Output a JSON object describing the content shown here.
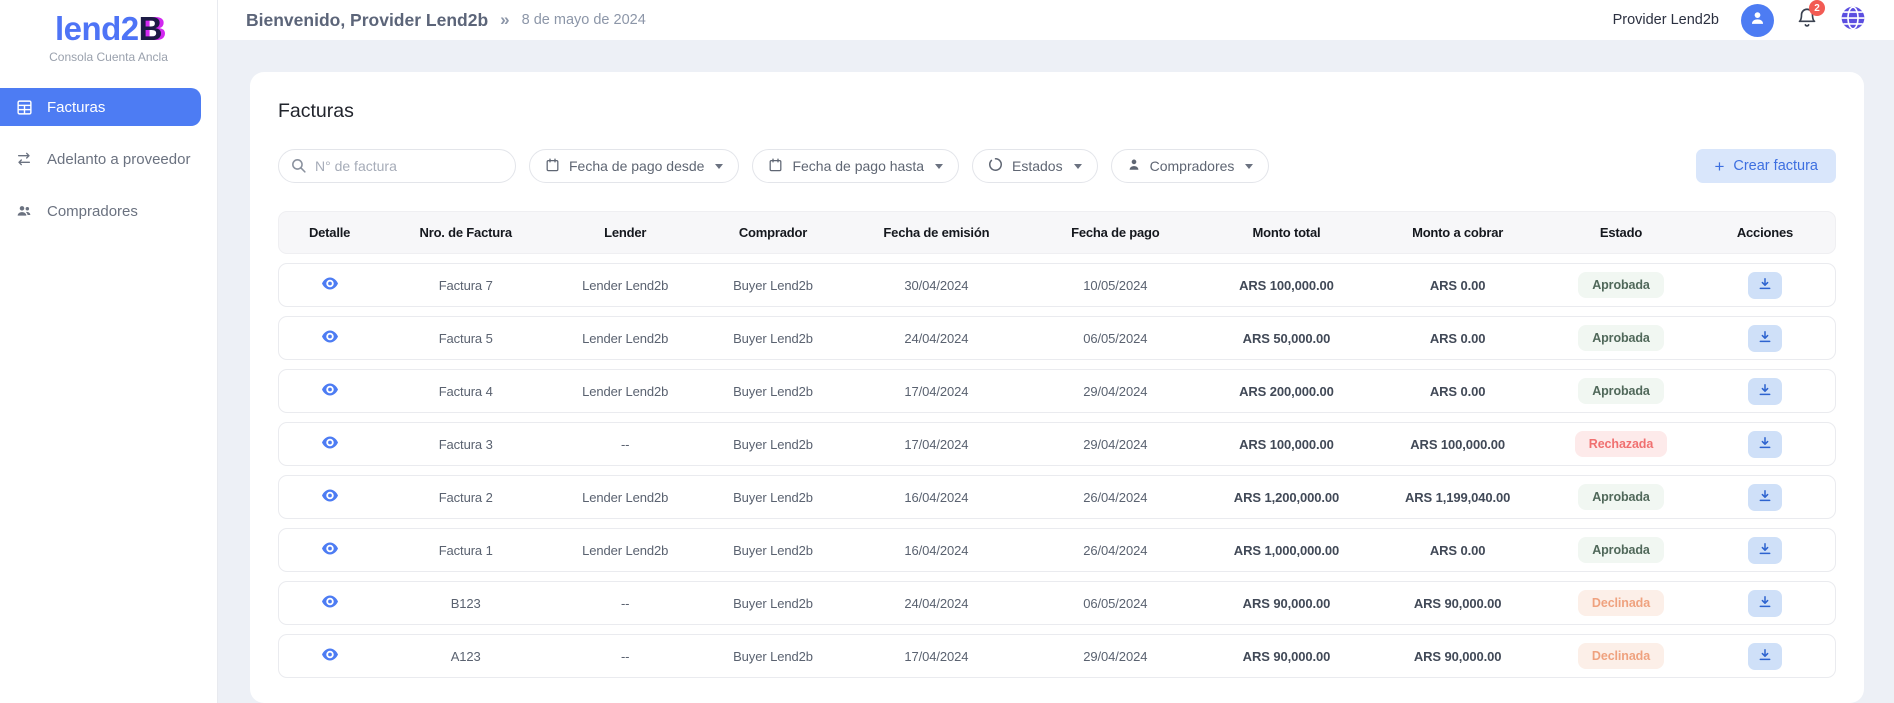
{
  "brand": {
    "name_primary": "lend2",
    "name_accent": "B",
    "tagline": "Consola Cuenta Ancla"
  },
  "sidebar": {
    "items": [
      {
        "label": "Facturas",
        "active": true
      },
      {
        "label": "Adelanto a proveedor",
        "active": false
      },
      {
        "label": "Compradores",
        "active": false
      }
    ]
  },
  "topbar": {
    "welcome": "Bienvenido, Provider Lend2b",
    "separator": "»",
    "date": "8 de mayo de 2024",
    "user_name": "Provider Lend2b",
    "notification_count": "2"
  },
  "content": {
    "title": "Facturas",
    "search_placeholder": "N° de factura",
    "filters": [
      {
        "label": "Fecha de pago desde"
      },
      {
        "label": "Fecha de pago hasta"
      },
      {
        "label": "Estados"
      },
      {
        "label": "Compradores"
      }
    ],
    "create_button_label": "Crear factura",
    "create_button_plus": "+"
  },
  "table": {
    "columns": [
      "Detalle",
      "Nro. de Factura",
      "Lender",
      "Comprador",
      "Fecha de emisión",
      "Fecha de pago",
      "Monto total",
      "Monto a cobrar",
      "Estado",
      "Acciones"
    ],
    "rows": [
      {
        "invoice": "Factura 7",
        "lender": "Lender Lend2b",
        "buyer": "Buyer Lend2b",
        "issue_date": "30/04/2024",
        "pay_date": "10/05/2024",
        "total": "ARS 100,000.00",
        "receivable": "ARS 0.00",
        "status": "Aprobada",
        "status_type": "approved"
      },
      {
        "invoice": "Factura 5",
        "lender": "Lender Lend2b",
        "buyer": "Buyer Lend2b",
        "issue_date": "24/04/2024",
        "pay_date": "06/05/2024",
        "total": "ARS 50,000.00",
        "receivable": "ARS 0.00",
        "status": "Aprobada",
        "status_type": "approved"
      },
      {
        "invoice": "Factura 4",
        "lender": "Lender Lend2b",
        "buyer": "Buyer Lend2b",
        "issue_date": "17/04/2024",
        "pay_date": "29/04/2024",
        "total": "ARS 200,000.00",
        "receivable": "ARS 0.00",
        "status": "Aprobada",
        "status_type": "approved"
      },
      {
        "invoice": "Factura 3",
        "lender": "--",
        "buyer": "Buyer Lend2b",
        "issue_date": "17/04/2024",
        "pay_date": "29/04/2024",
        "total": "ARS 100,000.00",
        "receivable": "ARS 100,000.00",
        "status": "Rechazada",
        "status_type": "rejected"
      },
      {
        "invoice": "Factura 2",
        "lender": "Lender Lend2b",
        "buyer": "Buyer Lend2b",
        "issue_date": "16/04/2024",
        "pay_date": "26/04/2024",
        "total": "ARS 1,200,000.00",
        "receivable": "ARS 1,199,040.00",
        "status": "Aprobada",
        "status_type": "approved"
      },
      {
        "invoice": "Factura 1",
        "lender": "Lender Lend2b",
        "buyer": "Buyer Lend2b",
        "issue_date": "16/04/2024",
        "pay_date": "26/04/2024",
        "total": "ARS 1,000,000.00",
        "receivable": "ARS 0.00",
        "status": "Aprobada",
        "status_type": "approved"
      },
      {
        "invoice": "B123",
        "lender": "--",
        "buyer": "Buyer Lend2b",
        "issue_date": "24/04/2024",
        "pay_date": "06/05/2024",
        "total": "ARS 90,000.00",
        "receivable": "ARS 90,000.00",
        "status": "Declinada",
        "status_type": "declined"
      },
      {
        "invoice": "A123",
        "lender": "--",
        "buyer": "Buyer Lend2b",
        "issue_date": "17/04/2024",
        "pay_date": "29/04/2024",
        "total": "ARS 90,000.00",
        "receivable": "ARS 90,000.00",
        "status": "Declinada",
        "status_type": "declined"
      }
    ]
  },
  "colors": {
    "accent_blue": "#4d7cf3",
    "logo_blue": "#4e74f6",
    "logo_navy": "#1d1b45",
    "logo_magenta": "#d228f0",
    "globe_purple": "#5b4ee0",
    "notification_red": "#f25b54",
    "create_button_bg": "#d9e6fb",
    "create_button_text": "#3d6fe0",
    "approved_text": "#50685a",
    "rejected_text": "#f07070",
    "declined_text": "#efa27f"
  }
}
